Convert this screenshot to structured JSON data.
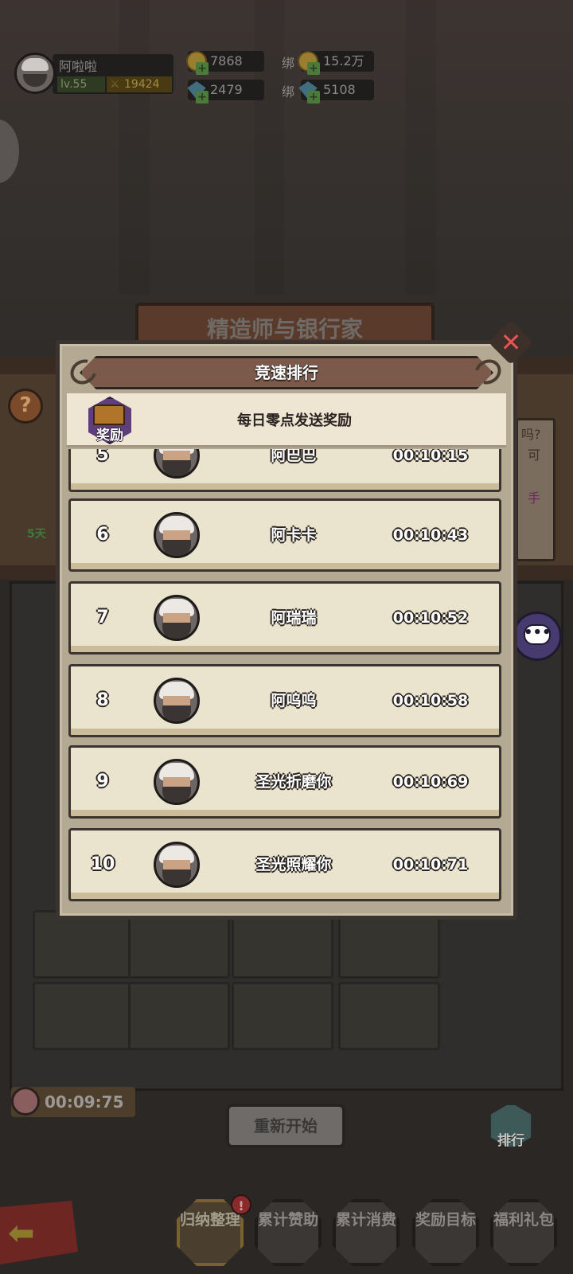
{
  "hud": {
    "player_name": "阿啦啦",
    "level": "lv.55",
    "power": "19424",
    "gold": "7868",
    "gems": "2479",
    "bind_label": "绑",
    "bound_gold": "15.2万",
    "bound_gems": "5108"
  },
  "background": {
    "title": "精造师与银行家",
    "help": "?",
    "side_texts": [
      "吗?",
      "可",
      "手"
    ],
    "side_badge": "5天"
  },
  "modal": {
    "title": "竞速排行",
    "reward_badge": "奖励",
    "reward_text": "每日零点发送奖励",
    "rows": [
      {
        "rank": "5",
        "name": "阿巴巴",
        "time": "00:10:15"
      },
      {
        "rank": "6",
        "name": "阿卡卡",
        "time": "00:10:43"
      },
      {
        "rank": "7",
        "name": "阿瑞瑞",
        "time": "00:10:52"
      },
      {
        "rank": "8",
        "name": "阿呜呜",
        "time": "00:10:58"
      },
      {
        "rank": "9",
        "name": "圣光折磨你",
        "time": "00:10:69"
      },
      {
        "rank": "10",
        "name": "圣光照耀你",
        "time": "00:10:71"
      }
    ]
  },
  "bottom": {
    "timer": "00:09:75",
    "restart": "重新开始",
    "rank_button": "排行",
    "menu": [
      {
        "label": "归纳整理",
        "badge": "!"
      },
      {
        "label": "累计赞助"
      },
      {
        "label": "累计消费"
      },
      {
        "label": "奖励目标"
      },
      {
        "label": "福利礼包"
      }
    ]
  },
  "colors": {
    "modal_bg": "#c7bca6",
    "row_bg": "#eae3cd",
    "header_bg": "#7b5a4c",
    "close": "#e05656"
  }
}
